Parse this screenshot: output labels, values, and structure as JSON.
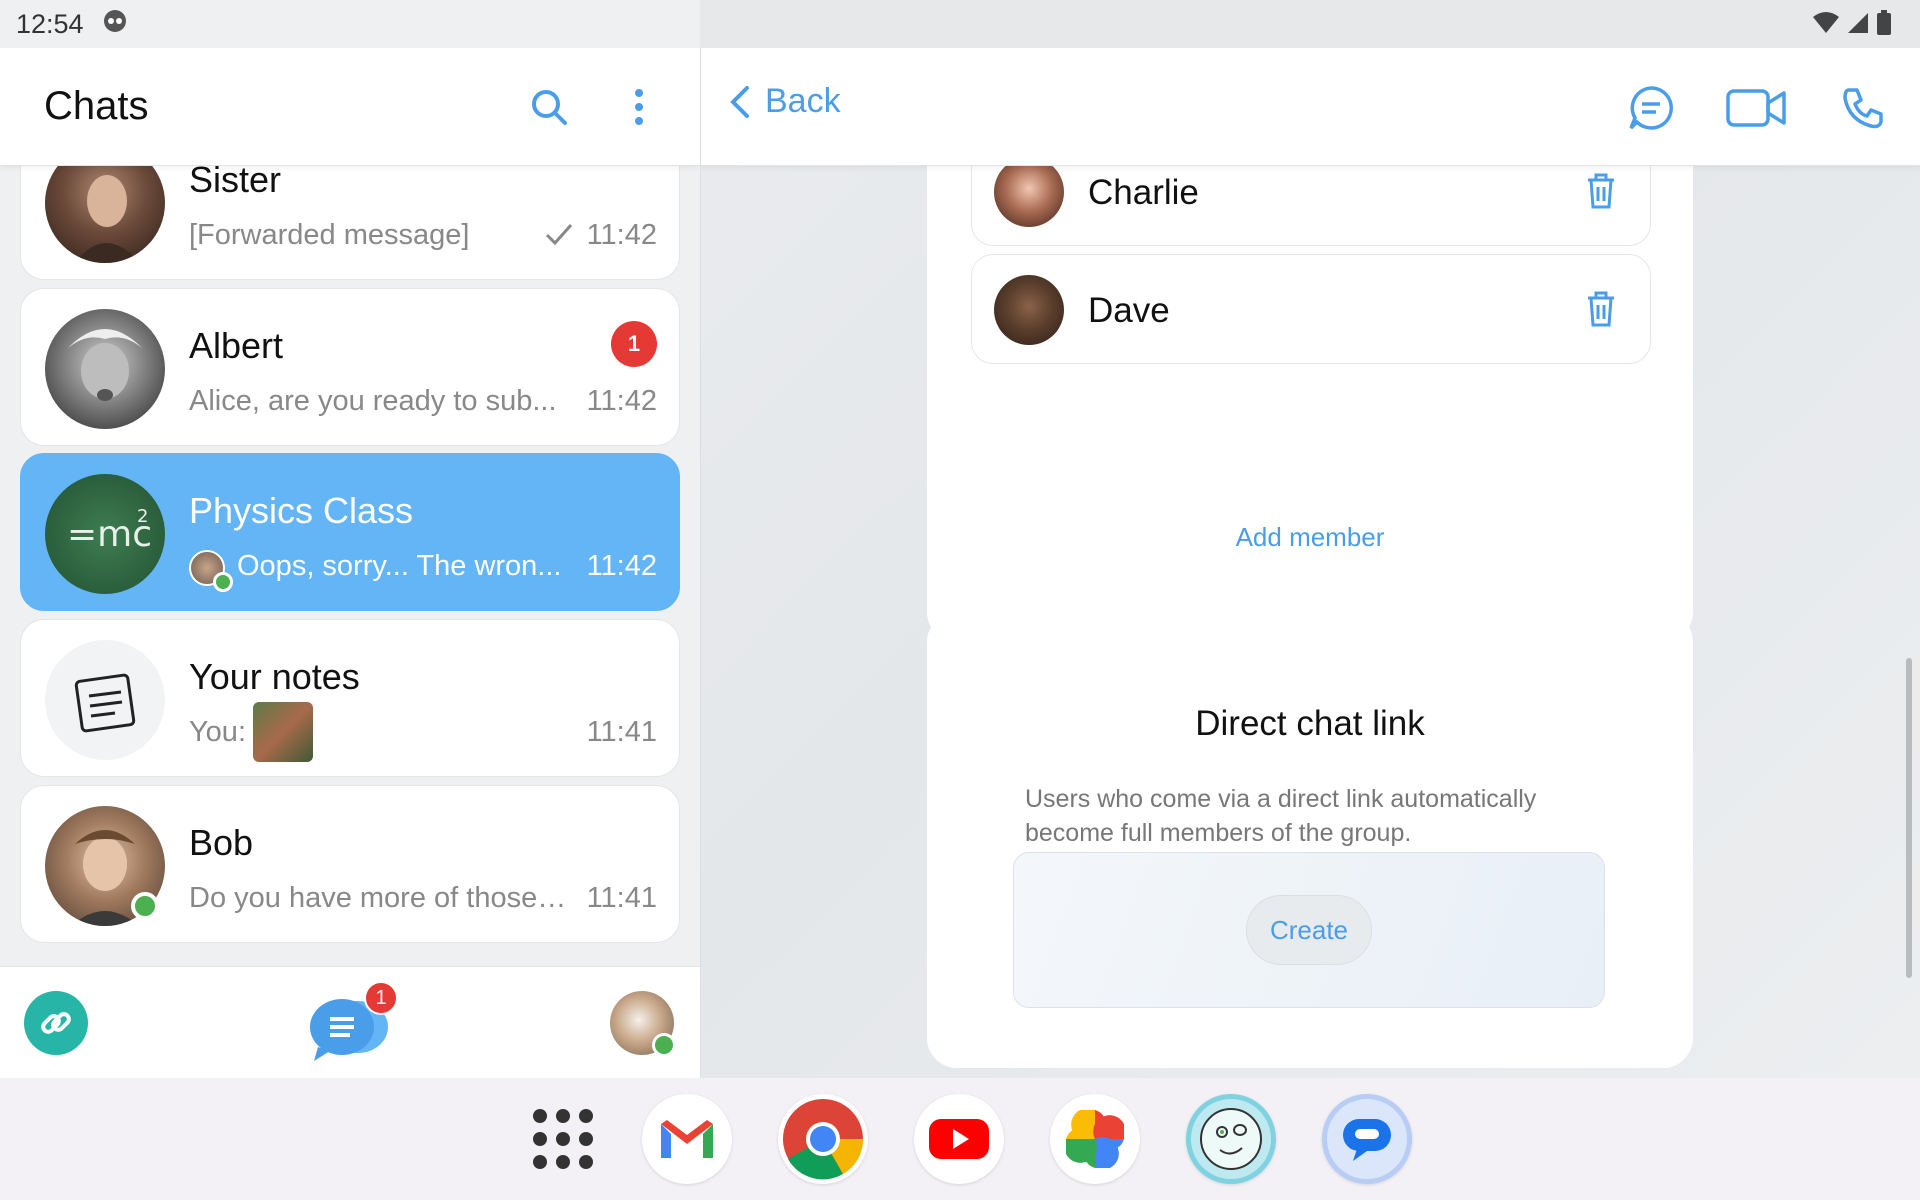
{
  "status_bar": {
    "time": "12:54"
  },
  "left": {
    "title": "Chats",
    "chats": [
      {
        "name": "Sister",
        "preview": "[Forwarded message]",
        "time": "11:42",
        "read_check": true
      },
      {
        "name": "Albert",
        "preview": "Alice, are you ready to sub...",
        "time": "11:42",
        "badge": "1"
      },
      {
        "name": "Physics Class",
        "preview": "Oops, sorry... The wron...",
        "time": "11:42",
        "active": true
      },
      {
        "name": "Your notes",
        "preview": "You:",
        "time": "11:41"
      },
      {
        "name": "Bob",
        "preview": "Do you have more of those ...",
        "time": "11:41"
      }
    ],
    "bottom_nav": {
      "chats_badge": "1"
    }
  },
  "right": {
    "back_label": "Back",
    "members": [
      {
        "name": "Charlie"
      },
      {
        "name": "Dave"
      }
    ],
    "add_member_label": "Add member",
    "direct_link": {
      "title": "Direct chat link",
      "description": "Users who come via a direct link automatically become full members of the group.",
      "create_label": "Create"
    }
  },
  "colors": {
    "accent": "#4a9de8",
    "active_chat": "#64b5f6",
    "badge": "#e53935",
    "online": "#4caf50"
  }
}
